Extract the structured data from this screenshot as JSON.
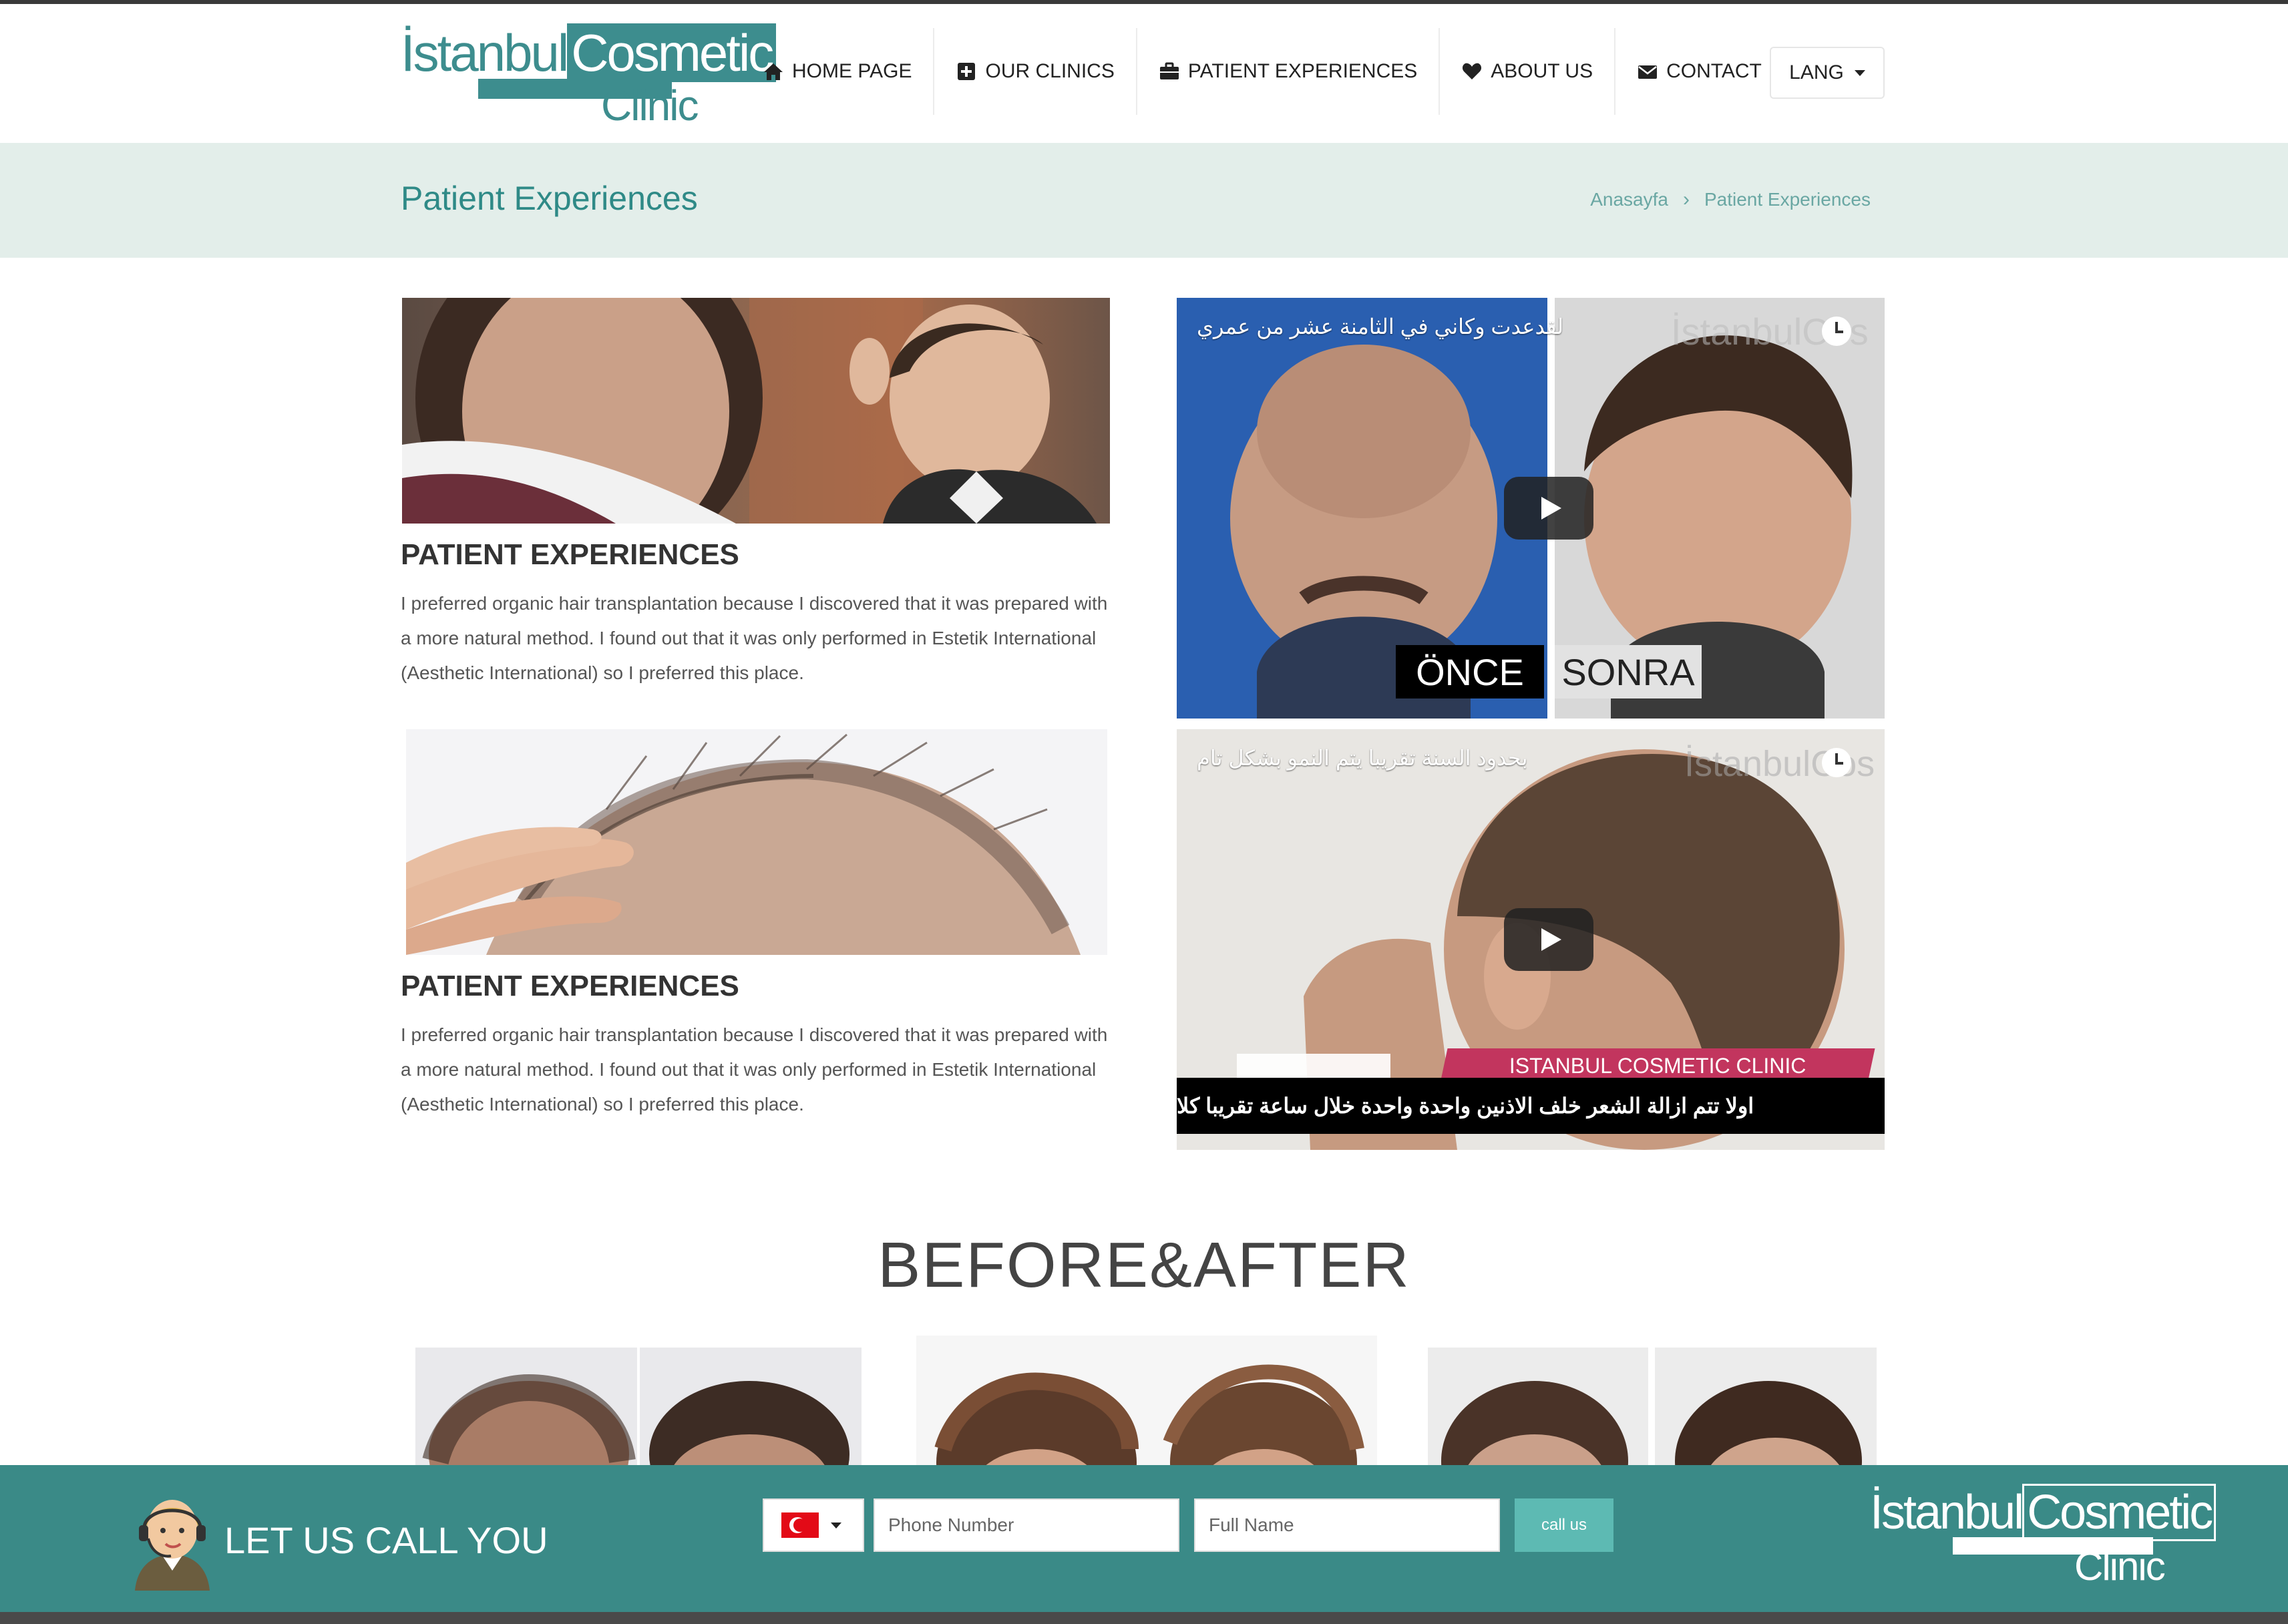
{
  "brand": {
    "logo_part1": "İstanbul",
    "logo_part2": "Cosmetic",
    "logo_part3": "Clinic"
  },
  "nav": {
    "items": [
      {
        "label": "HOME PAGE",
        "icon": "home-icon"
      },
      {
        "label": "OUR CLINICS",
        "icon": "plus-square-icon"
      },
      {
        "label": "PATIENT EXPERIENCES",
        "icon": "briefcase-icon"
      },
      {
        "label": "ABOUT US",
        "icon": "heart-icon"
      },
      {
        "label": "CONTACT",
        "icon": "envelope-icon"
      }
    ],
    "lang_label": "LANG"
  },
  "page": {
    "title": "Patient Experiences",
    "breadcrumb": [
      "Anasayfa",
      "Patient Experiences"
    ]
  },
  "experiences": [
    {
      "title": "PATIENT EXPERIENCES",
      "text": "I preferred organic hair transplantation because I discovered that it was prepared with a more natural method. I found out that it was only performed in Estetik International (Aesthetic International) so I preferred this place."
    },
    {
      "title": "PATIENT EXPERIENCES",
      "text": "I preferred organic hair transplantation because I discovered that it was prepared with a more natural method. I found out that it was only performed in Estetik International (Aesthetic International) so I preferred this place."
    }
  ],
  "videos": [
    {
      "caption": "لقدعدت وكاني في الثامنة عشر من عمري",
      "label_before": "ÖNCE",
      "label_after": "SONRA"
    },
    {
      "caption": "بحدود السنة تقريبا يتم النمو بشكل تام",
      "banner": "ISTANBUL COSMETIC CLINIC",
      "subtitle": "اولا تتم ازالة الشعر خلف الاذنين واحدة واحدة خلال ساعة تقريبا كلا"
    }
  ],
  "before_after": {
    "title": "BEFORE&AFTER"
  },
  "callback": {
    "cta": "LET US CALL YOU",
    "phone_placeholder": "Phone Number",
    "name_placeholder": "Full Name",
    "button": "call us",
    "country": "turkey-flag"
  },
  "colors": {
    "brand": "#3d8d8e",
    "title_band": "#e3eeea",
    "callbar": "#3a8a87",
    "button": "#5dbab3"
  }
}
